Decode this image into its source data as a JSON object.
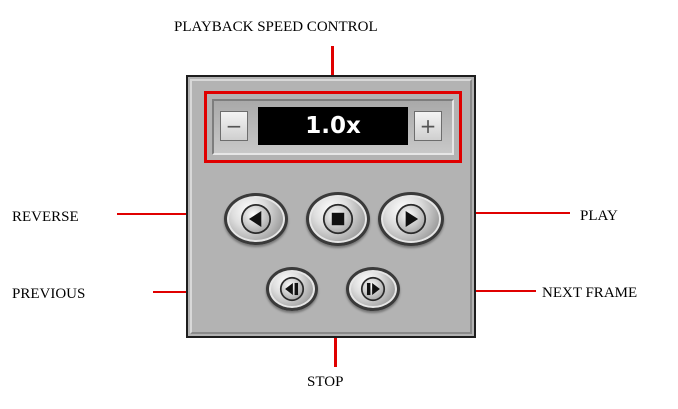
{
  "labels": {
    "speed_control": "PLAYBACK SPEED CONTROL",
    "reverse": "REVERSE",
    "play": "PLAY",
    "previous": "PREVIOUS",
    "next_frame": "NEXT FRAME",
    "stop": "STOP"
  },
  "speed_control": {
    "minus_label": "−",
    "value": "1.0x",
    "plus_label": "+"
  },
  "buttons": [
    {
      "name": "reverse",
      "icon": "triangle-left-icon"
    },
    {
      "name": "stop",
      "icon": "square-stop-icon"
    },
    {
      "name": "play",
      "icon": "triangle-right-icon"
    },
    {
      "name": "previous-frame",
      "icon": "step-back-icon"
    },
    {
      "name": "next-frame",
      "icon": "step-forward-icon"
    }
  ],
  "colors": {
    "callout": "#e00000",
    "panel": "#b3b3b3",
    "display_bg": "#000000",
    "display_text": "#ffffff"
  }
}
